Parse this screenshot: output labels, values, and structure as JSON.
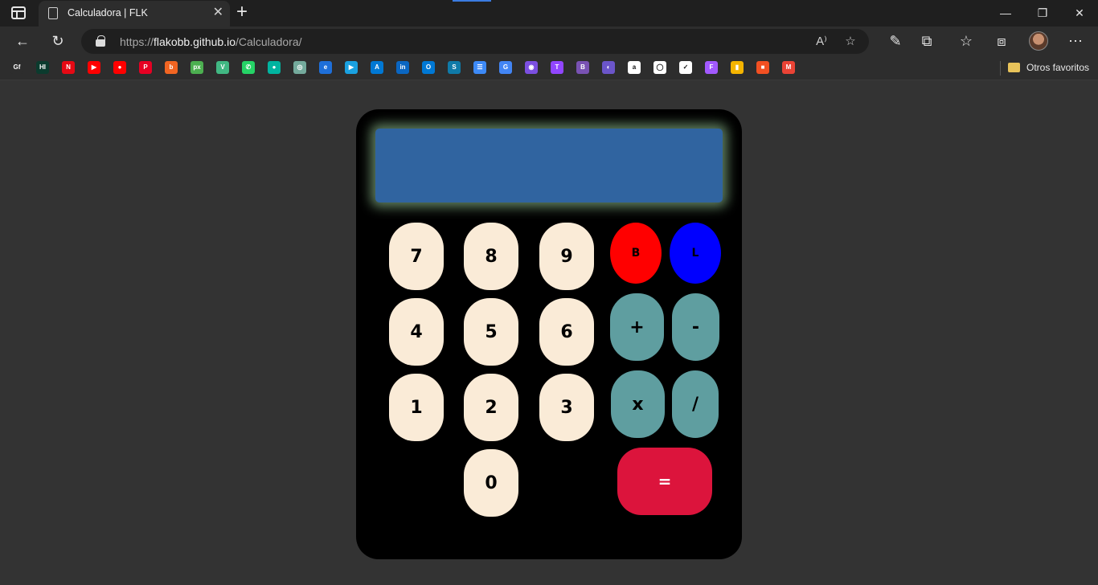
{
  "browser": {
    "tab_title": "Calculadora | FLK",
    "tab_close": "✕",
    "new_tab": "+",
    "url_prefix": "https://",
    "url_host": "flakobb.github.io",
    "url_path": "/Calculadora/",
    "window_controls": {
      "minimize": "—",
      "restore": "❐",
      "close": "✕"
    },
    "bookmarks_other": "Otros favoritos",
    "bookmark_icons": [
      {
        "name": "gf-icon",
        "color": "#2d2d2d",
        "text": "Gf"
      },
      {
        "name": "hm-icon",
        "color": "#0b3b2e",
        "text": "HI"
      },
      {
        "name": "netflix-icon",
        "color": "#e50914",
        "text": "N"
      },
      {
        "name": "youtube-icon",
        "color": "#ff0000",
        "text": "▶"
      },
      {
        "name": "youtube-music-icon",
        "color": "#ff0000",
        "text": "●"
      },
      {
        "name": "pinterest-icon",
        "color": "#e60023",
        "text": "P"
      },
      {
        "name": "b-icon",
        "color": "#f26522",
        "text": "b"
      },
      {
        "name": "px-icon",
        "color": "#4caf50",
        "text": "px"
      },
      {
        "name": "vue-icon",
        "color": "#41b883",
        "text": "V"
      },
      {
        "name": "whatsapp-icon",
        "color": "#25d366",
        "text": "✆"
      },
      {
        "name": "chat-icon",
        "color": "#00b4a0",
        "text": "●"
      },
      {
        "name": "openai-icon",
        "color": "#74aa9c",
        "text": "◎"
      },
      {
        "name": "edge-icon",
        "color": "#1e6fd9",
        "text": "e"
      },
      {
        "name": "play-icon",
        "color": "#1aa1e0",
        "text": "▶"
      },
      {
        "name": "azure-icon",
        "color": "#0078d4",
        "text": "A"
      },
      {
        "name": "linkedin-icon",
        "color": "#0a66c2",
        "text": "in"
      },
      {
        "name": "outlook-icon",
        "color": "#0078d4",
        "text": "O"
      },
      {
        "name": "s-icon",
        "color": "#0f7aa8",
        "text": "S"
      },
      {
        "name": "sheets-icon",
        "color": "#3d8af7",
        "text": "☰"
      },
      {
        "name": "translate-icon",
        "color": "#4285f4",
        "text": "G"
      },
      {
        "name": "camera-icon",
        "color": "#7b4fe0",
        "text": "◉"
      },
      {
        "name": "twitch-icon",
        "color": "#9146ff",
        "text": "T"
      },
      {
        "name": "bootstrap-icon",
        "color": "#7952b3",
        "text": "B"
      },
      {
        "name": "planet-icon",
        "color": "#6b55c9",
        "text": "◐"
      },
      {
        "name": "amazon-icon",
        "color": "#ffffff",
        "text": "a"
      },
      {
        "name": "github-icon",
        "color": "#ffffff",
        "text": "◯"
      },
      {
        "name": "doc-icon",
        "color": "#ffffff",
        "text": "✓"
      },
      {
        "name": "figma-icon",
        "color": "#a259ff",
        "text": "F"
      },
      {
        "name": "colors-icon",
        "color": "#f4b400",
        "text": "▮"
      },
      {
        "name": "microsoft-icon",
        "color": "#f25022",
        "text": "■"
      },
      {
        "name": "gmail-icon",
        "color": "#ea4335",
        "text": "M"
      }
    ]
  },
  "calculator": {
    "display_value": "",
    "keys": {
      "seven": "7",
      "eight": "8",
      "nine": "9",
      "four": "4",
      "five": "5",
      "six": "6",
      "one": "1",
      "two": "2",
      "three": "3",
      "zero": "0",
      "backspace": "B",
      "clear": "L",
      "plus": "+",
      "minus": "-",
      "multiply": "x",
      "divide": "/",
      "equals": "="
    },
    "colors": {
      "body": "#000000",
      "display": "#3064a0",
      "number_key": "#faebd7",
      "operator_key": "#5f9ea0",
      "backspace_key": "#ff0000",
      "clear_key": "#0000ff",
      "equals_key": "#dc143c"
    }
  }
}
